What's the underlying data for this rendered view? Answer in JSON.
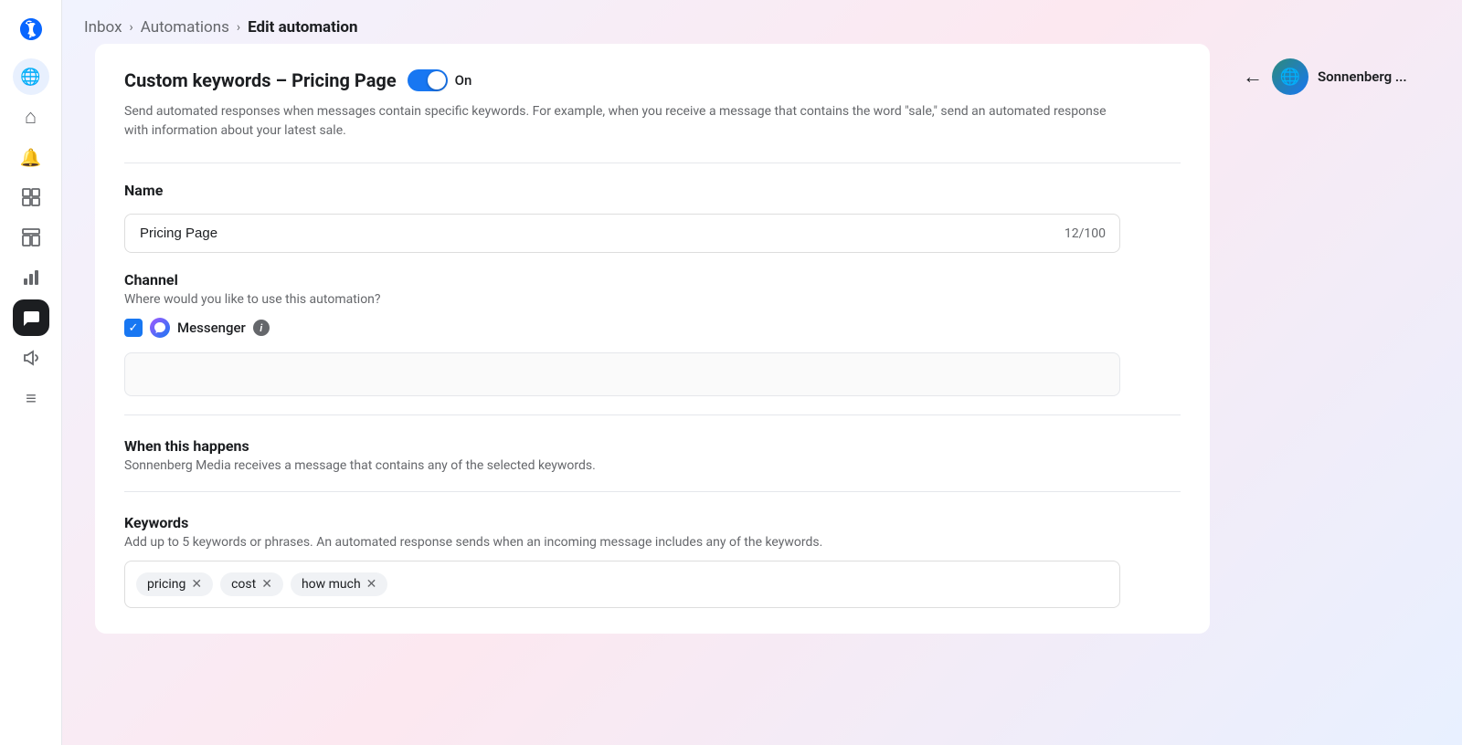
{
  "meta": {
    "logo": "🔷"
  },
  "breadcrumb": {
    "inbox": "Inbox",
    "automations": "Automations",
    "current": "Edit automation",
    "sep1": "›",
    "sep2": "›"
  },
  "automation": {
    "title": "Custom keywords – Pricing Page",
    "toggle_state": "On",
    "description": "Send automated responses when messages contain specific keywords. For example, when you receive a message that contains the word \"sale,\" send an automated response with information about your latest sale."
  },
  "name_section": {
    "label": "Name",
    "value": "Pricing Page",
    "char_count": "12/100"
  },
  "channel_section": {
    "label": "Channel",
    "subtitle": "Where would you like to use this automation?",
    "messenger_label": "Messenger"
  },
  "when_section": {
    "label": "When this happens",
    "description": "Sonnenberg Media receives a message that contains any of the selected keywords."
  },
  "keywords_section": {
    "label": "Keywords",
    "description": "Add up to 5 keywords or phrases. An automated response sends when an incoming message includes any of the keywords.",
    "tags": [
      {
        "text": "pricing",
        "id": "tag-pricing"
      },
      {
        "text": "cost",
        "id": "tag-cost"
      },
      {
        "text": "how much",
        "id": "tag-how-much"
      }
    ]
  },
  "right_panel": {
    "back_arrow": "←",
    "account_name": "Sonnenberg ..."
  },
  "sidebar_icons": [
    {
      "id": "globe",
      "symbol": "🌐",
      "active": false,
      "label": "globe-icon"
    },
    {
      "id": "home",
      "symbol": "⌂",
      "active": false,
      "label": "home-icon"
    },
    {
      "id": "bell",
      "symbol": "🔔",
      "active": false,
      "label": "notifications-icon"
    },
    {
      "id": "grid",
      "symbol": "⊞",
      "active": false,
      "label": "grid-icon"
    },
    {
      "id": "layout",
      "symbol": "▤",
      "active": false,
      "label": "layout-icon"
    },
    {
      "id": "chart",
      "symbol": "📊",
      "active": false,
      "label": "chart-icon"
    },
    {
      "id": "chat",
      "symbol": "💬",
      "active": true,
      "label": "chat-icon"
    },
    {
      "id": "megaphone",
      "symbol": "📣",
      "active": false,
      "label": "megaphone-icon"
    },
    {
      "id": "menu",
      "symbol": "≡",
      "active": false,
      "label": "menu-icon"
    }
  ]
}
